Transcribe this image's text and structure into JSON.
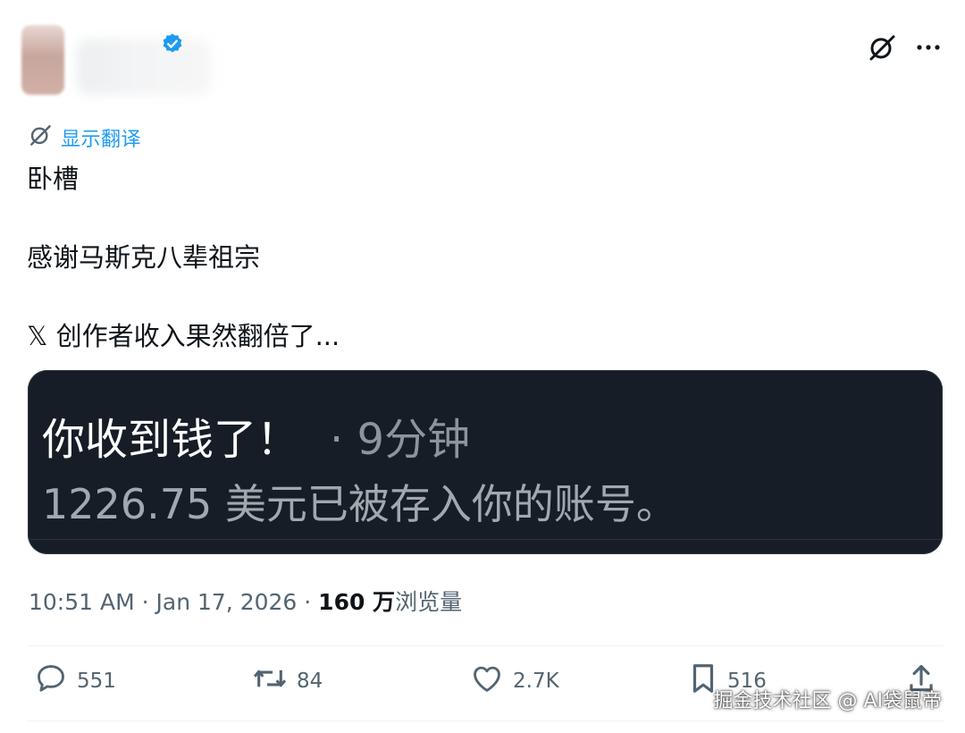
{
  "colors": {
    "accent": "#1d9bf0",
    "secondary_text": "#536471",
    "primary_text": "#0f1419",
    "media_bg": "#161d26"
  },
  "header": {
    "verified_icon": "verified-badge-icon",
    "grok_icon": "grok-icon",
    "more_icon": "more-icon"
  },
  "translate": {
    "label": "显示翻译",
    "icon": "translate-icon"
  },
  "post": {
    "text": "卧槽\n\n感谢马斯克八辈祖宗\n\n𝕏 创作者收入果然翻倍了..."
  },
  "media": {
    "title": "你收到钱了！",
    "time": "· 9分钟",
    "message": "1226.75 美元已被存入你的账号。"
  },
  "meta": {
    "timestamp": "10:51 AM · Jan 17, 2026 · ",
    "views_count": "160 万",
    "views_label": "浏览量"
  },
  "actions": {
    "replies": "551",
    "reposts": "84",
    "likes": "2.7K",
    "bookmarks": "516"
  },
  "watermark": "掘金技术社区 @ AI袋鼠帝"
}
